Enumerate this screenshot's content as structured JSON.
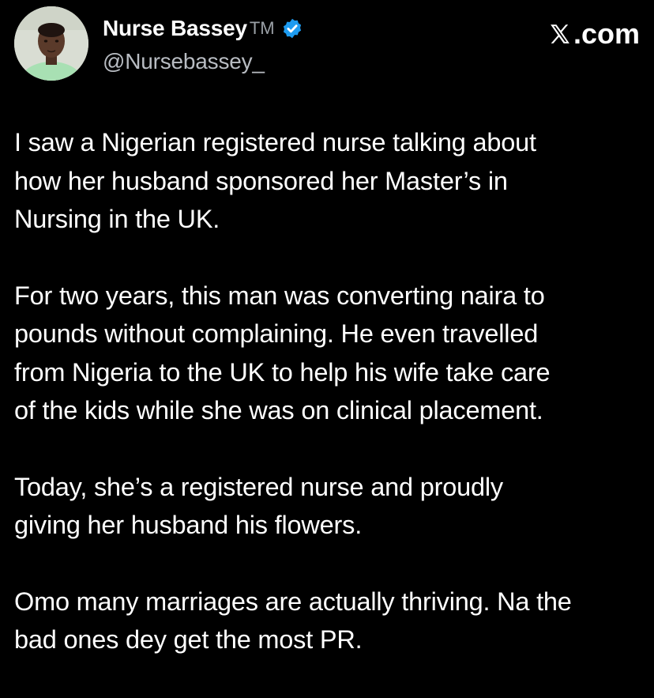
{
  "author": {
    "display_name": "Nurse Bassey",
    "tm": "TM",
    "handle": "@Nursebassey_",
    "verified_icon": "verified-badge-icon",
    "avatar": "profile-avatar"
  },
  "brand": {
    "icon": "x-logo-icon",
    "text": ".com"
  },
  "tweet": {
    "paragraphs": [
      "I saw a Nigerian registered nurse talking about\nhow her husband sponsored her Master’s in\nNursing in the UK.",
      "For two years, this man was converting naira to\npounds without complaining. He even travelled\nfrom Nigeria to the UK to help his wife take care\nof the kids while she was on clinical placement.",
      "Today, she’s a registered nurse and proudly\ngiving her husband his flowers.",
      "Omo many marriages are actually thriving. Na the\nbad ones dey get the most PR."
    ]
  },
  "colors": {
    "background": "#000000",
    "text": "#ffffff",
    "handle": "#b8bcc2",
    "verified": "#1d9bf0"
  }
}
